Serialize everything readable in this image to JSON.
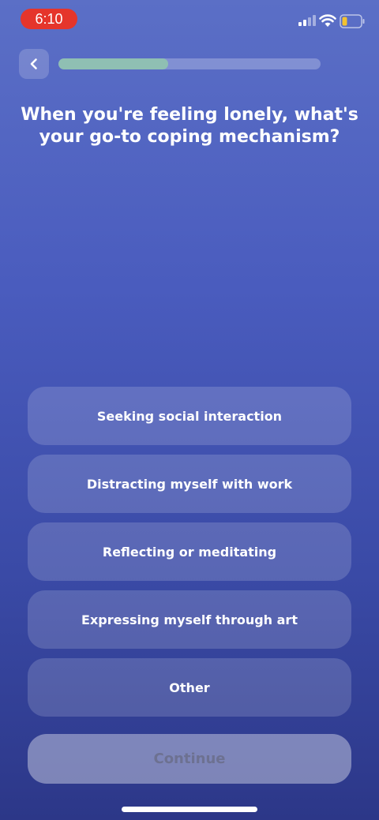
{
  "status_bar": {
    "time": "6:10",
    "icons": [
      "signal-icon",
      "wifi-icon",
      "battery-icon"
    ],
    "time_pill_color": "#e5352b"
  },
  "header": {
    "back_icon": "chevron-left-icon",
    "progress_fraction": 0.42,
    "progress_color": "#8fbfb3"
  },
  "question": {
    "title": "When you're feeling lonely, what's your go-to coping mechanism?"
  },
  "options": [
    "Seeking social interaction",
    "Distracting myself with work",
    "Reflecting or meditating",
    "Expressing myself through art",
    "Other"
  ],
  "footer": {
    "continue_label": "Continue"
  },
  "colors": {
    "background_top": "#5b6fc6",
    "background_bottom": "#2c3788"
  }
}
